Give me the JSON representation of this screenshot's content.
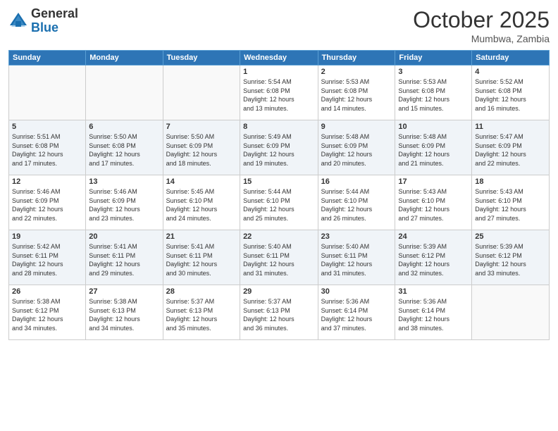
{
  "header": {
    "logo_general": "General",
    "logo_blue": "Blue",
    "month": "October 2025",
    "location": "Mumbwa, Zambia"
  },
  "weekdays": [
    "Sunday",
    "Monday",
    "Tuesday",
    "Wednesday",
    "Thursday",
    "Friday",
    "Saturday"
  ],
  "weeks": [
    [
      {
        "day": "",
        "info": ""
      },
      {
        "day": "",
        "info": ""
      },
      {
        "day": "",
        "info": ""
      },
      {
        "day": "1",
        "info": "Sunrise: 5:54 AM\nSunset: 6:08 PM\nDaylight: 12 hours\nand 13 minutes."
      },
      {
        "day": "2",
        "info": "Sunrise: 5:53 AM\nSunset: 6:08 PM\nDaylight: 12 hours\nand 14 minutes."
      },
      {
        "day": "3",
        "info": "Sunrise: 5:53 AM\nSunset: 6:08 PM\nDaylight: 12 hours\nand 15 minutes."
      },
      {
        "day": "4",
        "info": "Sunrise: 5:52 AM\nSunset: 6:08 PM\nDaylight: 12 hours\nand 16 minutes."
      }
    ],
    [
      {
        "day": "5",
        "info": "Sunrise: 5:51 AM\nSunset: 6:08 PM\nDaylight: 12 hours\nand 17 minutes."
      },
      {
        "day": "6",
        "info": "Sunrise: 5:50 AM\nSunset: 6:08 PM\nDaylight: 12 hours\nand 17 minutes."
      },
      {
        "day": "7",
        "info": "Sunrise: 5:50 AM\nSunset: 6:09 PM\nDaylight: 12 hours\nand 18 minutes."
      },
      {
        "day": "8",
        "info": "Sunrise: 5:49 AM\nSunset: 6:09 PM\nDaylight: 12 hours\nand 19 minutes."
      },
      {
        "day": "9",
        "info": "Sunrise: 5:48 AM\nSunset: 6:09 PM\nDaylight: 12 hours\nand 20 minutes."
      },
      {
        "day": "10",
        "info": "Sunrise: 5:48 AM\nSunset: 6:09 PM\nDaylight: 12 hours\nand 21 minutes."
      },
      {
        "day": "11",
        "info": "Sunrise: 5:47 AM\nSunset: 6:09 PM\nDaylight: 12 hours\nand 22 minutes."
      }
    ],
    [
      {
        "day": "12",
        "info": "Sunrise: 5:46 AM\nSunset: 6:09 PM\nDaylight: 12 hours\nand 22 minutes."
      },
      {
        "day": "13",
        "info": "Sunrise: 5:46 AM\nSunset: 6:09 PM\nDaylight: 12 hours\nand 23 minutes."
      },
      {
        "day": "14",
        "info": "Sunrise: 5:45 AM\nSunset: 6:10 PM\nDaylight: 12 hours\nand 24 minutes."
      },
      {
        "day": "15",
        "info": "Sunrise: 5:44 AM\nSunset: 6:10 PM\nDaylight: 12 hours\nand 25 minutes."
      },
      {
        "day": "16",
        "info": "Sunrise: 5:44 AM\nSunset: 6:10 PM\nDaylight: 12 hours\nand 26 minutes."
      },
      {
        "day": "17",
        "info": "Sunrise: 5:43 AM\nSunset: 6:10 PM\nDaylight: 12 hours\nand 27 minutes."
      },
      {
        "day": "18",
        "info": "Sunrise: 5:43 AM\nSunset: 6:10 PM\nDaylight: 12 hours\nand 27 minutes."
      }
    ],
    [
      {
        "day": "19",
        "info": "Sunrise: 5:42 AM\nSunset: 6:11 PM\nDaylight: 12 hours\nand 28 minutes."
      },
      {
        "day": "20",
        "info": "Sunrise: 5:41 AM\nSunset: 6:11 PM\nDaylight: 12 hours\nand 29 minutes."
      },
      {
        "day": "21",
        "info": "Sunrise: 5:41 AM\nSunset: 6:11 PM\nDaylight: 12 hours\nand 30 minutes."
      },
      {
        "day": "22",
        "info": "Sunrise: 5:40 AM\nSunset: 6:11 PM\nDaylight: 12 hours\nand 31 minutes."
      },
      {
        "day": "23",
        "info": "Sunrise: 5:40 AM\nSunset: 6:11 PM\nDaylight: 12 hours\nand 31 minutes."
      },
      {
        "day": "24",
        "info": "Sunrise: 5:39 AM\nSunset: 6:12 PM\nDaylight: 12 hours\nand 32 minutes."
      },
      {
        "day": "25",
        "info": "Sunrise: 5:39 AM\nSunset: 6:12 PM\nDaylight: 12 hours\nand 33 minutes."
      }
    ],
    [
      {
        "day": "26",
        "info": "Sunrise: 5:38 AM\nSunset: 6:12 PM\nDaylight: 12 hours\nand 34 minutes."
      },
      {
        "day": "27",
        "info": "Sunrise: 5:38 AM\nSunset: 6:13 PM\nDaylight: 12 hours\nand 34 minutes."
      },
      {
        "day": "28",
        "info": "Sunrise: 5:37 AM\nSunset: 6:13 PM\nDaylight: 12 hours\nand 35 minutes."
      },
      {
        "day": "29",
        "info": "Sunrise: 5:37 AM\nSunset: 6:13 PM\nDaylight: 12 hours\nand 36 minutes."
      },
      {
        "day": "30",
        "info": "Sunrise: 5:36 AM\nSunset: 6:14 PM\nDaylight: 12 hours\nand 37 minutes."
      },
      {
        "day": "31",
        "info": "Sunrise: 5:36 AM\nSunset: 6:14 PM\nDaylight: 12 hours\nand 38 minutes."
      },
      {
        "day": "",
        "info": ""
      }
    ]
  ]
}
